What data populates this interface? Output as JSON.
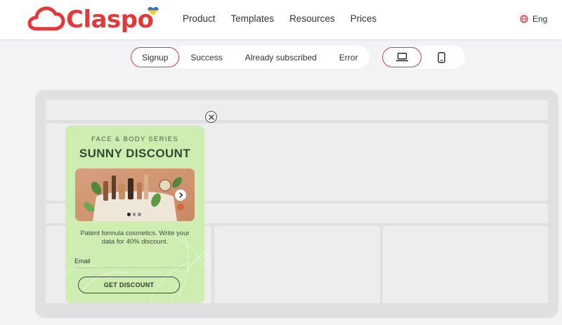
{
  "header": {
    "logo_text": "Claspo",
    "nav": [
      "Product",
      "Templates",
      "Resources",
      "Prices"
    ],
    "language": "Eng"
  },
  "state_tabs": [
    {
      "label": "Signup",
      "active": true
    },
    {
      "label": "Success",
      "active": false
    },
    {
      "label": "Already subscribed",
      "active": false
    },
    {
      "label": "Error",
      "active": false
    }
  ],
  "devices": [
    {
      "icon": "laptop-icon",
      "active": true
    },
    {
      "icon": "mobile-icon",
      "active": false
    }
  ],
  "popup": {
    "subtitle": "FACE & BODY SERIES",
    "title": "SUNNY DISCOUNT",
    "description": "Patent formula cosmetics. Write your data for 40% discount.",
    "email_placeholder": "Email",
    "button_label": "GET DISCOUNT",
    "carousel_slides": 3,
    "carousel_current": 1,
    "background_color": "#cdeeb0"
  },
  "colors": {
    "brand": "#e23a3a",
    "accent_outline": "#d8373b"
  }
}
